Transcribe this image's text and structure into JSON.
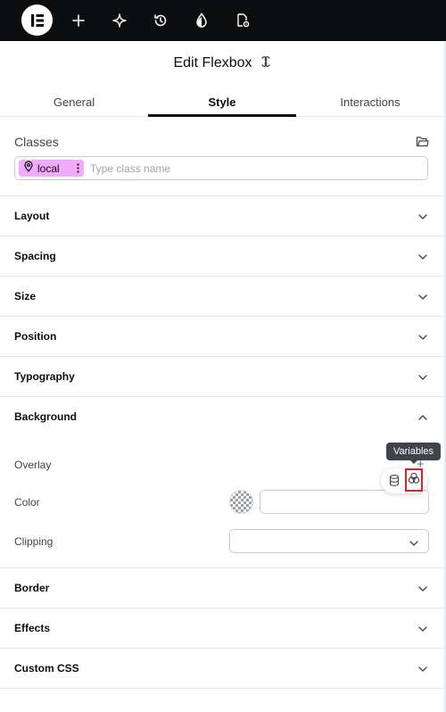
{
  "topbar": {
    "icons": [
      "elementor-logo-icon",
      "plus-icon",
      "ai-sparkle-icon",
      "history-icon",
      "theme-drop-icon",
      "page-settings-icon"
    ]
  },
  "panel": {
    "title": "Edit Flexbox",
    "title_icon": "flexbox-icon",
    "tabs": [
      {
        "label": "General",
        "active": false
      },
      {
        "label": "Style",
        "active": true
      },
      {
        "label": "Interactions",
        "active": false
      }
    ]
  },
  "classes": {
    "label": "Classes",
    "chip_label": "local",
    "placeholder": "Type class name"
  },
  "sections": {
    "layout": "Layout",
    "spacing": "Spacing",
    "size": "Size",
    "position": "Position",
    "typography": "Typography",
    "background": "Background",
    "border": "Border",
    "effects": "Effects",
    "custom_css": "Custom CSS"
  },
  "background": {
    "overlay_label": "Overlay",
    "overlay_add": "+",
    "color_label": "Color",
    "color_value": "",
    "clipping_label": "Clipping",
    "clipping_value": "",
    "tooltip": "Variables"
  },
  "colors": {
    "topbar": "#0c0d0e",
    "chip": "#f0abfc",
    "highlight": "#e0202e",
    "tooltip": "#3f444b"
  }
}
